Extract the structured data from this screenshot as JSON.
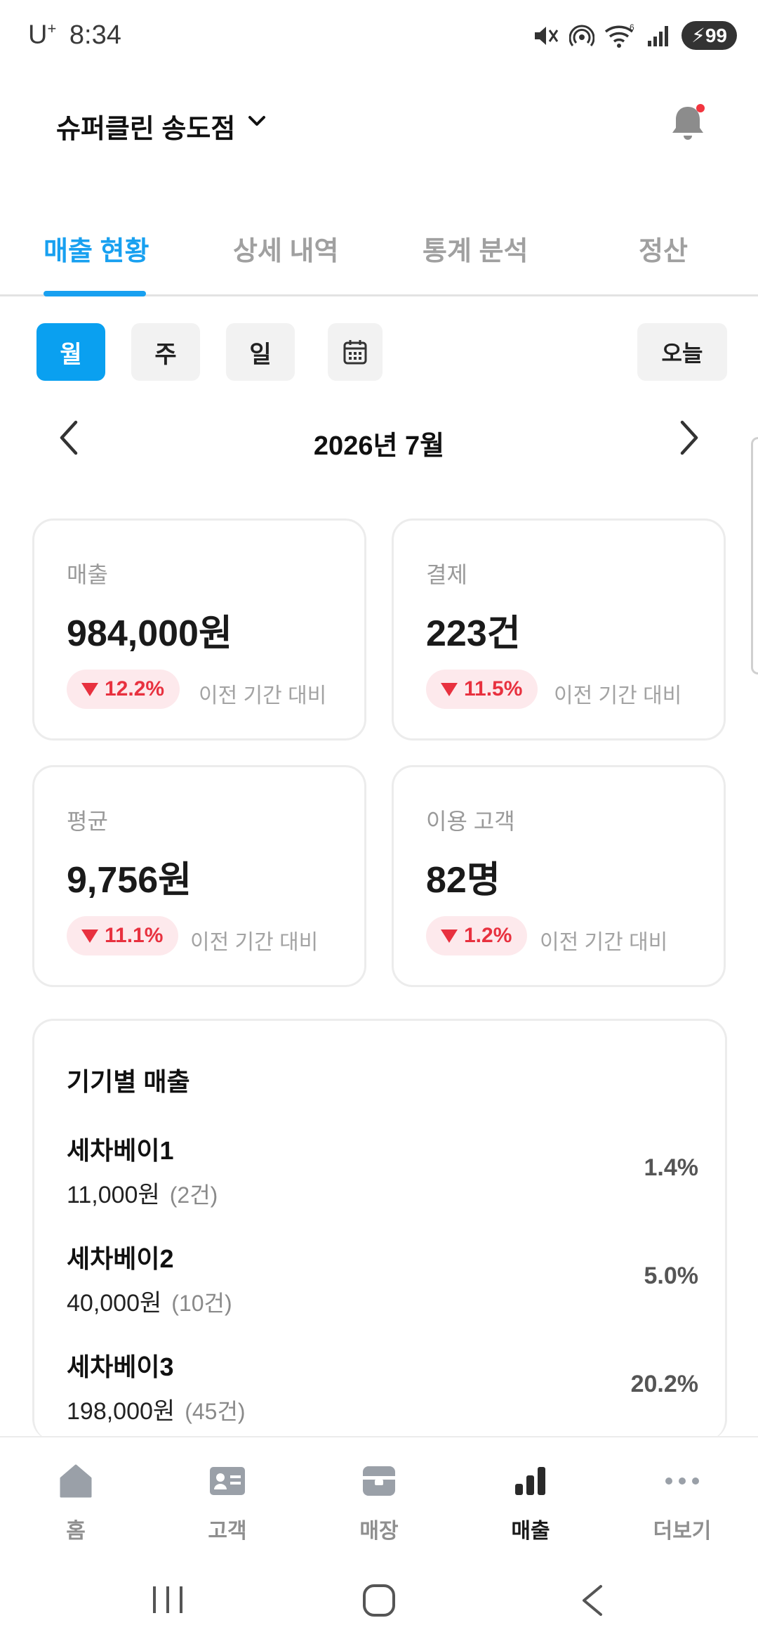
{
  "status_bar": {
    "carrier": "U",
    "carrier_sup": "+",
    "time": "8:34",
    "battery": "99"
  },
  "header": {
    "store_name": "슈퍼클린 송도점"
  },
  "tabs": [
    {
      "label": "매출 현황",
      "active": true
    },
    {
      "label": "상세 내역",
      "active": false
    },
    {
      "label": "통계 분석",
      "active": false
    },
    {
      "label": "정산",
      "active": false
    }
  ],
  "period": {
    "month": "월",
    "week": "주",
    "day": "일",
    "today": "오늘"
  },
  "month_nav": {
    "label": "2026년 7월"
  },
  "stats": {
    "sales": {
      "label": "매출",
      "value": "984,000원",
      "change": "12.2%",
      "compare": "이전 기간 대비"
    },
    "payments": {
      "label": "결제",
      "value": "223건",
      "change": "11.5%",
      "compare": "이전 기간 대비"
    },
    "average": {
      "label": "평균",
      "value": "9,756원",
      "change": "11.1%",
      "compare": "이전 기간 대비"
    },
    "customers": {
      "label": "이용 고객",
      "value": "82명",
      "change": "1.2%",
      "compare": "이전 기간 대비"
    }
  },
  "device_sales": {
    "title": "기기별 매출",
    "items": [
      {
        "name": "세차베이1",
        "amount": "11,000원",
        "count": "(2건)",
        "pct": "1.4%"
      },
      {
        "name": "세차베이2",
        "amount": "40,000원",
        "count": "(10건)",
        "pct": "5.0%"
      },
      {
        "name": "세차베이3",
        "amount": "198,000원",
        "count": "(45건)",
        "pct": "20.2%"
      }
    ]
  },
  "bottom_nav": {
    "home": "홈",
    "customer": "고객",
    "store": "매장",
    "sales": "매출",
    "more": "더보기"
  },
  "colors": {
    "accent": "#18a0f0",
    "negative": "#e8313f",
    "negative_bg": "#fde9ec"
  }
}
